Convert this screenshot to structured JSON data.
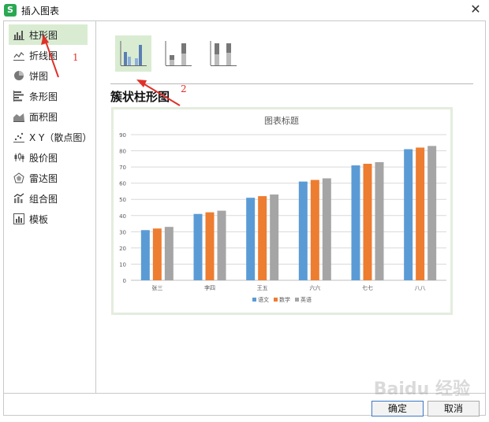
{
  "window": {
    "title": "插入图表",
    "close_glyph": "✕",
    "app_glyph": "S"
  },
  "sidebar": {
    "items": [
      {
        "label": "柱形图",
        "icon": "bar-chart-icon",
        "active": true
      },
      {
        "label": "折线图",
        "icon": "line-chart-icon"
      },
      {
        "label": "饼图",
        "icon": "pie-chart-icon"
      },
      {
        "label": "条形图",
        "icon": "horizontal-bar-chart-icon"
      },
      {
        "label": "面积图",
        "icon": "area-chart-icon"
      },
      {
        "label": "X Y（散点图）",
        "icon": "scatter-chart-icon"
      },
      {
        "label": "股价图",
        "icon": "stock-chart-icon"
      },
      {
        "label": "雷达图",
        "icon": "radar-chart-icon"
      },
      {
        "label": "组合图",
        "icon": "combo-chart-icon"
      },
      {
        "label": "模板",
        "icon": "template-icon"
      }
    ]
  },
  "subtypes": [
    {
      "name": "clustered-column",
      "active": true
    },
    {
      "name": "stacked-column"
    },
    {
      "name": "percent-stacked-column"
    }
  ],
  "chart_type_title": "簇状柱形图",
  "buttons": {
    "ok": "确定",
    "cancel": "取消"
  },
  "annotations": {
    "one": "1",
    "two": "2"
  },
  "watermark": "Baidu 经验",
  "colors": {
    "accent_green": "#d9ecd2",
    "series1": "#5b9bd5",
    "series2": "#ed7d31",
    "series3": "#a5a5a5",
    "annotation_red": "#e0302a"
  },
  "chart_data": {
    "type": "bar",
    "title": "图表标题",
    "categories": [
      "张三",
      "李四",
      "王五",
      "六六",
      "七七",
      "八八"
    ],
    "series": [
      {
        "name": "语文",
        "values": [
          31,
          41,
          51,
          61,
          71,
          81
        ]
      },
      {
        "name": "数学",
        "values": [
          32,
          42,
          52,
          62,
          72,
          82
        ]
      },
      {
        "name": "英语",
        "values": [
          33,
          43,
          53,
          63,
          73,
          83
        ]
      }
    ],
    "ylim": [
      0,
      90
    ],
    "yticks": [
      0,
      10,
      20,
      30,
      40,
      50,
      60,
      70,
      80,
      90
    ],
    "grid": true,
    "legend": "bottom"
  }
}
